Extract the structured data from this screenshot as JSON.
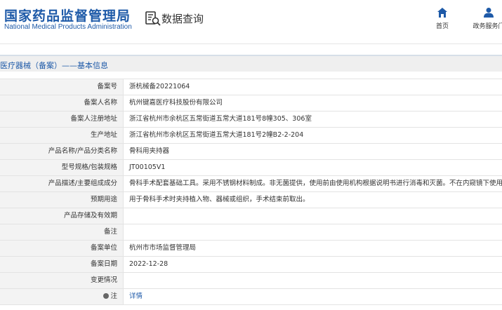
{
  "header": {
    "logo_cn": "国家药品监督管理局",
    "logo_en": "National Medical Products Administration",
    "page_title": "数据查询",
    "nav": [
      {
        "label": "首页",
        "icon": "home-icon"
      },
      {
        "label": "政务服务门",
        "icon": "user-icon"
      }
    ]
  },
  "section": {
    "title": "医疗器械（备案）——基本信息"
  },
  "rows": [
    {
      "label": "备案号",
      "value": "浙杭械备20221064"
    },
    {
      "label": "备案人名称",
      "value": "杭州键嘉医疗科技股份有限公司"
    },
    {
      "label": "备案人注册地址",
      "value": "浙江省杭州市余杭区五常街道五常大道181号8幢305、306室"
    },
    {
      "label": "生产地址",
      "value": "浙江省杭州市余杭区五常街道五常大道181号2幢B2-2-204"
    },
    {
      "label": "产品名称/产品分类名称",
      "value": "骨科用夹持器"
    },
    {
      "label": "型号规格/包装规格",
      "value": "JT00105V1"
    },
    {
      "label": "产品描述/主要组成成分",
      "value": "骨科手术配套基础工具。采用不锈钢材料制成。非无菌提供，使用前由使用机构根据说明书进行消毒和灭菌。不在内窥镜下使用。"
    },
    {
      "label": "预期用途",
      "value": "用于骨科手术时夹持植入物、器械或组织，手术结束前取出。"
    },
    {
      "label": "产品存储及有效期",
      "value": ""
    },
    {
      "label": "备注",
      "value": ""
    },
    {
      "label": "备案单位",
      "value": "杭州市市场监督管理局"
    },
    {
      "label": "备案日期",
      "value": "2022-12-28"
    },
    {
      "label": "变更情况",
      "value": ""
    },
    {
      "label": "注",
      "value": "详情"
    }
  ],
  "colors": {
    "brand": "#1e5aa8",
    "label_bg": "#f3f3f3",
    "section_bg": "#efefef"
  }
}
